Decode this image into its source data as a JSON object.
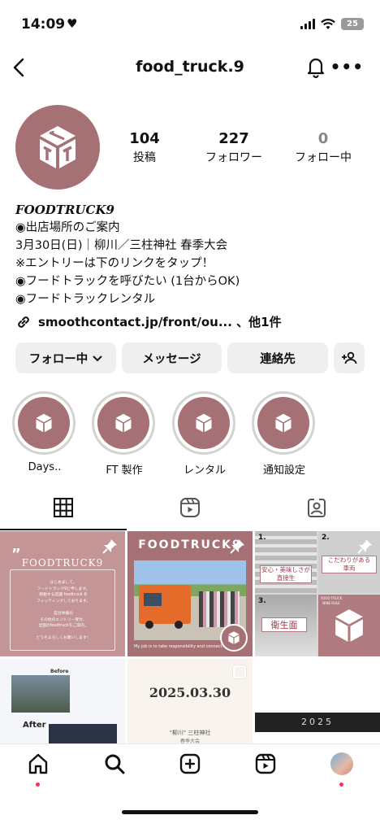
{
  "status_bar": {
    "time": "14:09",
    "battery": "25"
  },
  "header": {
    "username": "food_truck.9"
  },
  "profile": {
    "stats": [
      {
        "value": "104",
        "label": "投稿"
      },
      {
        "value": "227",
        "label": "フォロワー"
      },
      {
        "value": "0",
        "label": "フォロー中"
      }
    ],
    "display_name": "FOODTRUCK9",
    "bio_lines": [
      "◉出店場所のご案内",
      "3月30日(日)｜柳川／三柱神社 春季大会",
      "※エントリーは下のリンクをタップ！",
      "◉フードトラックを呼びたい (1台からOK)",
      "◉フードトラックレンタル"
    ],
    "link_text": "smoothcontact.jp/front/ou... 、他1件"
  },
  "actions": {
    "following": "フォロー中",
    "message": "メッセージ",
    "contact": "連絡先"
  },
  "highlights": [
    {
      "label": "Days.."
    },
    {
      "label": "FT 製作"
    },
    {
      "label": "レンタル"
    },
    {
      "label": "通知設定"
    }
  ],
  "posts": {
    "p1": {
      "title": "FOODTRUCK9",
      "body_lines": [
        "はじめまして。",
        "フードトラック9と申します。",
        "移動する店舗 foodtruck を",
        "フィッティングしております。",
        "",
        "自治体様の",
        "その他のエントリー受付、",
        "全国のfoodtruckをご案内。",
        "",
        "どうぞよろしくお願いします！"
      ]
    },
    "p2": {
      "title": "FOODTRUCK9",
      "caption": "My job is to take responsibility and connect."
    },
    "p3": {
      "tag_a": "安心・美味しさが",
      "tag_a2": "直接生",
      "tag_b": "こだわりがある",
      "tag_b2": "車両",
      "tag_c": "衛生面",
      "n1": "1.",
      "n2": "2.",
      "n3": "3.",
      "side": "FOOD TRUCK NINE RULE"
    },
    "p4": {
      "before": "Before",
      "after": "After"
    },
    "p5": {
      "date": "2025.03.30",
      "line1": "\"柳川\" 三柱神社",
      "line2": "春季大会"
    },
    "p6": {
      "year": "2025"
    }
  },
  "colors": {
    "brand": "#a57174",
    "accent": "#ff2d55"
  }
}
